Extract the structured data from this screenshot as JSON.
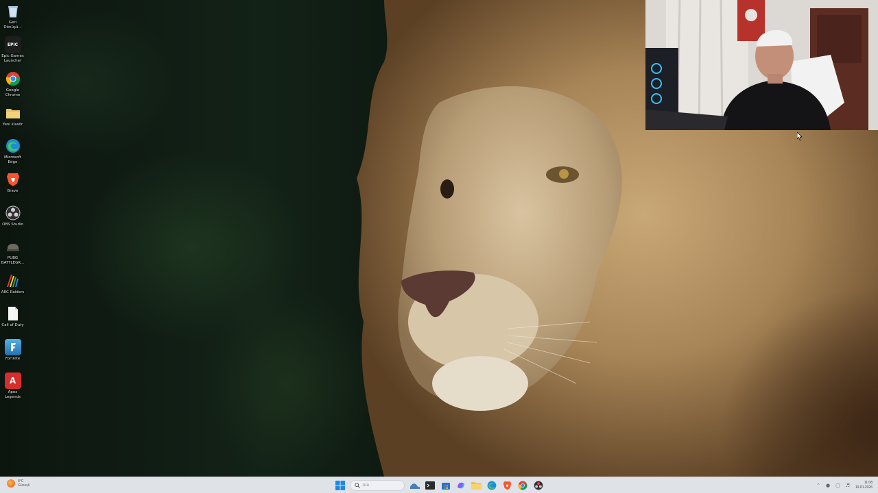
{
  "desktop": {
    "icons": [
      {
        "label": "Geri\nDönüşü...",
        "icon": "recycle-bin-icon"
      },
      {
        "label": "Epic Games\nLauncher",
        "icon": "epic-games-icon",
        "glyph": "EPIC"
      },
      {
        "label": "Google\nChrome",
        "icon": "chrome-icon"
      },
      {
        "label": "Yeni klasör",
        "icon": "folder-icon"
      },
      {
        "label": "Microsoft\nEdge",
        "icon": "edge-icon"
      },
      {
        "label": "Brave",
        "icon": "brave-icon"
      },
      {
        "label": "OBS Studio",
        "icon": "obs-icon"
      },
      {
        "label": "PUBG\nBATTLEGR...",
        "icon": "pubg-icon"
      },
      {
        "label": "ARC Raiders",
        "icon": "arc-raiders-icon"
      },
      {
        "label": "Call of Duty",
        "icon": "call-of-duty-icon"
      },
      {
        "label": "Fortnite",
        "icon": "fortnite-icon"
      },
      {
        "label": "Apex\nLegends",
        "icon": "apex-legends-icon",
        "glyph": "A"
      }
    ]
  },
  "taskbar": {
    "weather": {
      "temp": "8°C",
      "condition": "Güneşli"
    },
    "search": {
      "placeholder": "Ara"
    },
    "pinned": [
      {
        "name": "start-button",
        "icon": "windows-icon"
      },
      {
        "name": "widgets-button",
        "icon": "widgets-icon"
      },
      {
        "name": "taskbar-app-terminal",
        "icon": "terminal-icon"
      },
      {
        "name": "taskbar-app-store",
        "icon": "store-icon"
      },
      {
        "name": "taskbar-app-copilot",
        "icon": "copilot-icon"
      },
      {
        "name": "taskbar-app-explorer",
        "icon": "folder-icon"
      },
      {
        "name": "taskbar-app-edge",
        "icon": "edge-icon"
      },
      {
        "name": "taskbar-app-brave",
        "icon": "brave-icon"
      },
      {
        "name": "taskbar-app-chrome",
        "icon": "chrome-icon"
      },
      {
        "name": "taskbar-app-obs",
        "icon": "obs-icon"
      }
    ],
    "tray": {
      "time": "11:08",
      "date": "19.01.2026"
    }
  },
  "colors": {
    "taskbar_bg": "#dfe3e8",
    "accent": "#0067c0"
  }
}
